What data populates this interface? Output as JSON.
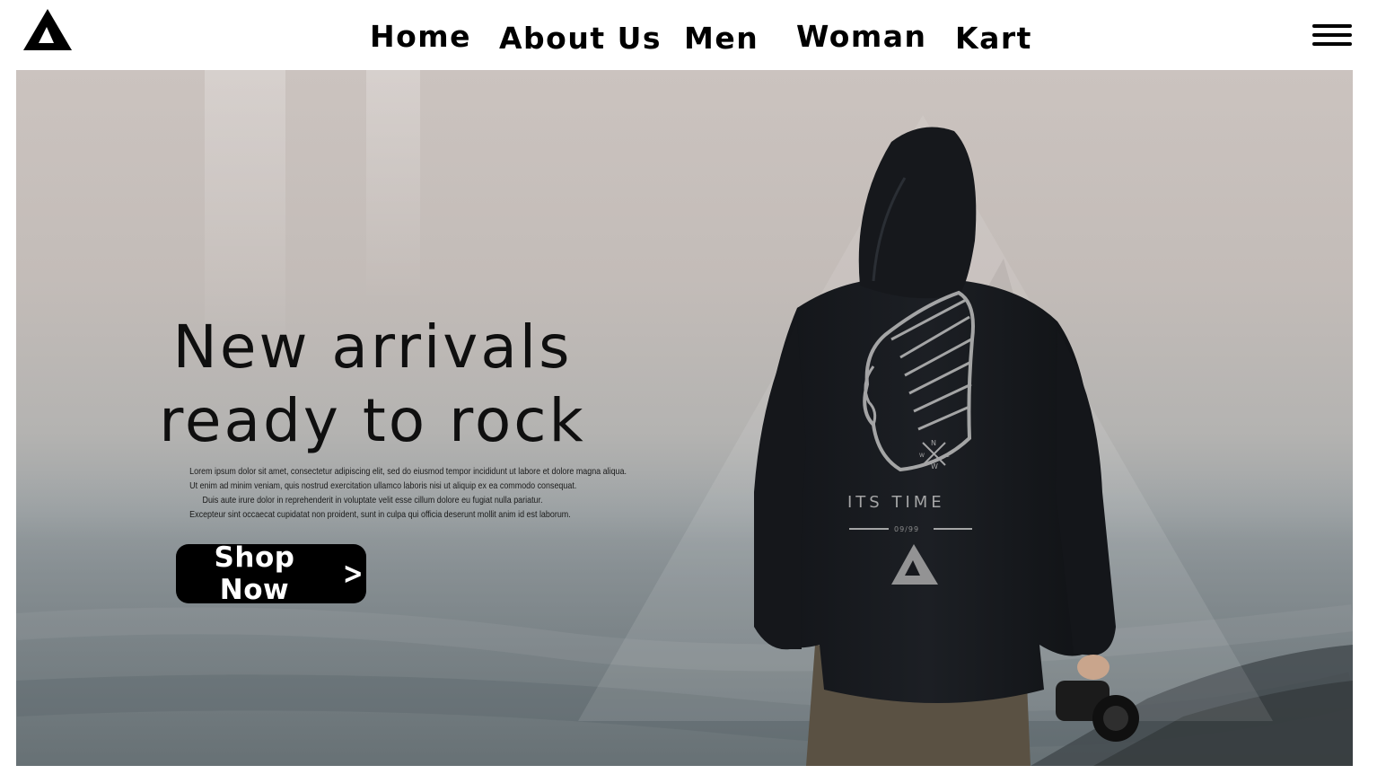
{
  "header": {
    "logo_icon": "brand-a-triangle-icon",
    "nav": [
      {
        "label": "Home"
      },
      {
        "label": "About Us"
      },
      {
        "label": "Men"
      },
      {
        "label": "Woman"
      },
      {
        "label": "Kart"
      }
    ],
    "menu_icon": "hamburger-menu-icon"
  },
  "hero": {
    "headline_line1": "New arrivals",
    "headline_line2": "ready to rock",
    "body_lines": [
      "Lorem ipsum dolor sit amet, consectetur adipiscing elit, sed do eiusmod tempor incididunt ut labore et dolore magna aliqua.",
      "Ut enim ad minim veniam, quis nostrud exercitation ullamco laboris nisi ut aliquip ex ea commodo consequat.",
      "Duis aute irure dolor in reprehenderit in voluptate velit esse cillum dolore eu fugiat nulla pariatur.",
      "Excepteur sint occaecat cupidatat non proident, sunt in culpa qui officia deserunt mollit anim id est laborum."
    ],
    "cta_label": "Shop Now",
    "cta_icon": "chevron-right-icon",
    "hoodie_print": {
      "title": "ITS TIME",
      "date": "09/99",
      "compass_letters": [
        "N",
        "E",
        "W",
        "W"
      ]
    }
  },
  "colors": {
    "accent": "#000000",
    "header_bg": "#ffffff",
    "sky_top": "#cbc3bf",
    "sea": "#7b8387",
    "hoodie": "#16181c"
  }
}
